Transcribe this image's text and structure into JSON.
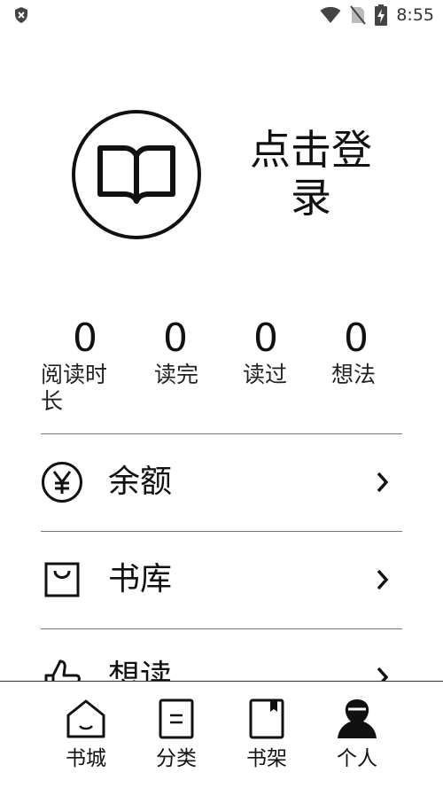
{
  "status_bar": {
    "time": "8:55"
  },
  "profile": {
    "login_label": "点击登录"
  },
  "stats": [
    {
      "value": "0",
      "label": "阅读时长"
    },
    {
      "value": "0",
      "label": "读完"
    },
    {
      "value": "0",
      "label": "读过"
    },
    {
      "value": "0",
      "label": "想法"
    }
  ],
  "menu": [
    {
      "label": "余额",
      "icon": "yen-icon"
    },
    {
      "label": "书库",
      "icon": "bag-icon"
    },
    {
      "label": "想读",
      "icon": "thumbs-up-icon"
    }
  ],
  "bottom_nav": [
    {
      "label": "书城",
      "icon": "home-icon"
    },
    {
      "label": "分类",
      "icon": "category-icon"
    },
    {
      "label": "书架",
      "icon": "bookshelf-icon"
    },
    {
      "label": "个人",
      "icon": "person-icon",
      "active": true
    }
  ]
}
